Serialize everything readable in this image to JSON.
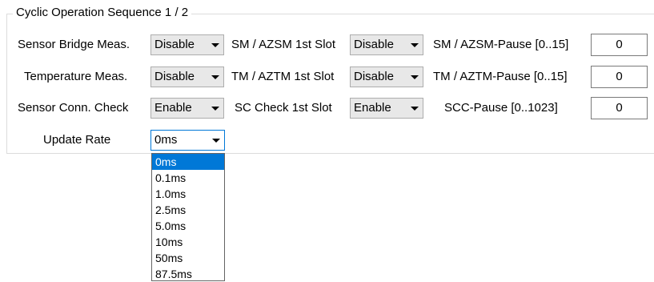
{
  "group": {
    "title": "Cyclic Operation Sequence 1 / 2"
  },
  "rows": [
    {
      "label": "Sensor Bridge Meas.",
      "select_value": "Disable",
      "slot_label": "SM / AZSM 1st Slot",
      "slot_value": "Disable",
      "pause_label": "SM / AZSM-Pause [0..15]",
      "pause_value": "0"
    },
    {
      "label": "Temperature Meas.",
      "select_value": "Disable",
      "slot_label": "TM / AZTM 1st Slot",
      "slot_value": "Disable",
      "pause_label": "TM / AZTM-Pause [0..15]",
      "pause_value": "0"
    },
    {
      "label": "Sensor Conn. Check",
      "select_value": "Enable",
      "slot_label": "SC Check 1st Slot",
      "slot_value": "Enable",
      "pause_label": "SCC-Pause [0..1023]",
      "pause_value": "0"
    }
  ],
  "update_rate": {
    "label": "Update Rate",
    "value": "0ms",
    "options": [
      "0ms",
      "0.1ms",
      "1.0ms",
      "2.5ms",
      "5.0ms",
      "10ms",
      "50ms",
      "87.5ms"
    ],
    "selected_index": 0
  },
  "icons": {
    "dropdown_arrow": "chevron-down-icon"
  },
  "colors": {
    "highlight": "#0078d7",
    "combo_bg": "#e8e8e8"
  }
}
